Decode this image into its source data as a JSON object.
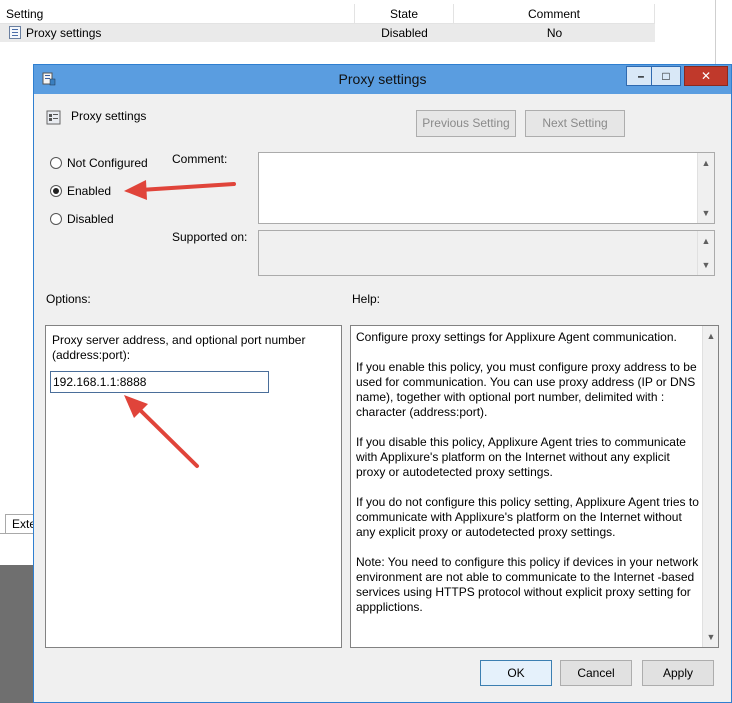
{
  "list": {
    "columns": [
      "Setting",
      "State",
      "Comment"
    ],
    "rows": [
      {
        "setting": "Proxy settings",
        "state": "Disabled",
        "comment": "No"
      }
    ],
    "bottom_tab": "Exte"
  },
  "dialog": {
    "title": "Proxy settings",
    "titlebar_buttons": {
      "minimize": "–",
      "maximize": "□",
      "close": "✕"
    },
    "setting_name": "Proxy settings",
    "previous_button": "Previous Setting",
    "next_button": "Next Setting",
    "radio_options": [
      {
        "label": "Not Configured",
        "checked": false
      },
      {
        "label": "Enabled",
        "checked": true
      },
      {
        "label": "Disabled",
        "checked": false
      }
    ],
    "comment_label": "Comment:",
    "supported_on_label": "Supported on:",
    "options_label": "Options:",
    "help_label": "Help:",
    "option_description": "Proxy server address, and optional port number (address:port):",
    "proxy_value": "192.168.1.1:8888",
    "help_paragraphs": [
      "Configure proxy settings for Applixure Agent communication.",
      "If you enable this policy, you must configure proxy address to be used for communication. You can use proxy address (IP or DNS name), together with optional port number, delimited with : character (address:port).",
      "If you disable this policy, Applixure Agent tries to communicate with Applixure's platform on the Internet without any explicit proxy or autodetected proxy settings.",
      "If you do not configure this policy setting, Applixure Agent tries to communicate with Applixure's platform on the Internet without any explicit proxy or autodetected proxy settings.",
      "Note: You need to configure this policy if devices in your network environment are not able to communicate to the Internet -based services using HTTPS protocol without explicit proxy setting for appplictions."
    ],
    "ok_button": "OK",
    "cancel_button": "Cancel",
    "apply_button": "Apply"
  },
  "colors": {
    "titlebar": "#5a9de0",
    "annotation_arrow": "#e0443a"
  }
}
